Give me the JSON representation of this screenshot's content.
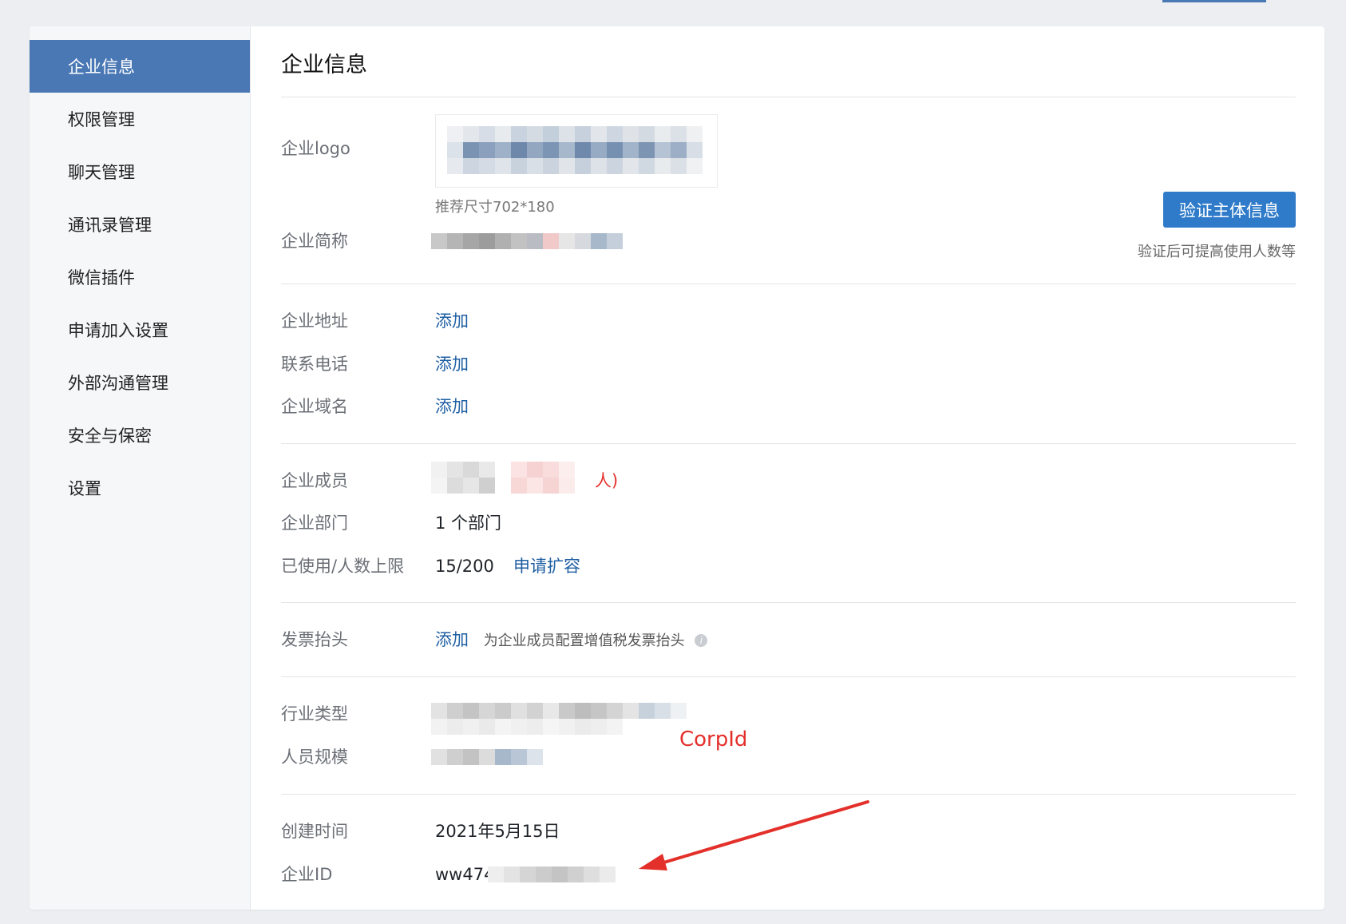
{
  "sidebar": {
    "items": [
      {
        "label": "企业信息",
        "active": true
      },
      {
        "label": "权限管理"
      },
      {
        "label": "聊天管理"
      },
      {
        "label": "通讯录管理"
      },
      {
        "label": "微信插件"
      },
      {
        "label": "申请加入设置"
      },
      {
        "label": "外部沟通管理"
      },
      {
        "label": "安全与保密"
      },
      {
        "label": "设置"
      }
    ]
  },
  "main": {
    "title": "企业信息",
    "logo": {
      "label": "企业logo",
      "caption": "推荐尺寸702*180"
    },
    "short_name": {
      "label": "企业简称"
    },
    "verify": {
      "button": "验证主体信息",
      "note": "验证后可提高使用人数等"
    },
    "address": {
      "label": "企业地址",
      "action": "添加"
    },
    "phone": {
      "label": "联系电话",
      "action": "添加"
    },
    "domain": {
      "label": "企业域名",
      "action": "添加"
    },
    "members": {
      "label": "企业成员",
      "suffix": "人)"
    },
    "departments": {
      "label": "企业部门",
      "value": "1 个部门"
    },
    "usage": {
      "label": "已使用/人数上限",
      "value": "15/200",
      "action": "申请扩容"
    },
    "invoice": {
      "label": "发票抬头",
      "action": "添加",
      "hint": "为企业成员配置增值税发票抬头",
      "info_icon": "i"
    },
    "industry": {
      "label": "行业类型"
    },
    "scale": {
      "label": "人员规模"
    },
    "created": {
      "label": "创建时间",
      "value": "2021年5月15日"
    },
    "corp_id": {
      "label": "企业ID",
      "value_prefix": "ww474"
    }
  },
  "annotation": {
    "text": "CorpId",
    "color": "#e3302b"
  },
  "colors": {
    "accent": "#4a78b5",
    "button": "#2f7bc9",
    "link": "#1f5fa3"
  }
}
